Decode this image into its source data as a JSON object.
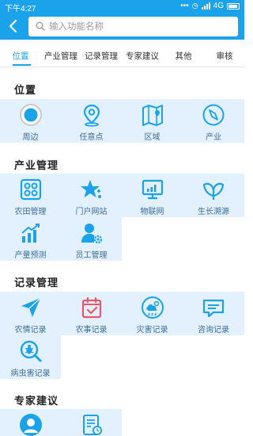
{
  "status_bar": {
    "time": "下午4:27",
    "network": "4G"
  },
  "search": {
    "back_icon": "back-arrow-icon",
    "placeholder": "输入功能名称"
  },
  "tabs": [
    "位置",
    "产业管理",
    "记录管理",
    "专家建议",
    "其他",
    "审核"
  ],
  "active_tab": 0,
  "colors": {
    "accent": "#1aa3ea",
    "cell_bg": "#e2f1fd",
    "label": "#3e6d9a",
    "icon_red": "#e35a6d"
  },
  "sections": [
    {
      "title": "位置",
      "items": [
        {
          "label": "周边",
          "icon": "target-circle-icon"
        },
        {
          "label": "任意点",
          "icon": "map-pin-icon"
        },
        {
          "label": "区域",
          "icon": "folded-map-icon"
        },
        {
          "label": "产业",
          "icon": "compass-icon"
        }
      ]
    },
    {
      "title": "产业管理",
      "items": [
        {
          "label": "农田管理",
          "icon": "farmland-grid-icon"
        },
        {
          "label": "门户网站",
          "icon": "star-icon"
        },
        {
          "label": "物联网",
          "icon": "monitor-chart-icon"
        },
        {
          "label": "生长溯源",
          "icon": "sprout-icon"
        },
        {
          "label": "产量预测",
          "icon": "rising-bars-icon"
        },
        {
          "label": "员工管理",
          "icon": "user-gear-icon"
        }
      ]
    },
    {
      "title": "记录管理",
      "items": [
        {
          "label": "农情记录",
          "icon": "paper-plane-icon"
        },
        {
          "label": "农事记录",
          "icon": "calendar-check-icon"
        },
        {
          "label": "灾害记录",
          "icon": "weather-icon"
        },
        {
          "label": "咨询记录",
          "icon": "chat-bubble-icon"
        },
        {
          "label": "病虫害记录",
          "icon": "bug-search-icon"
        }
      ]
    },
    {
      "title": "专家建议",
      "items": [
        {
          "label": "",
          "icon": "expert-avatar-icon"
        },
        {
          "label": "",
          "icon": "document-clock-icon"
        }
      ]
    }
  ]
}
